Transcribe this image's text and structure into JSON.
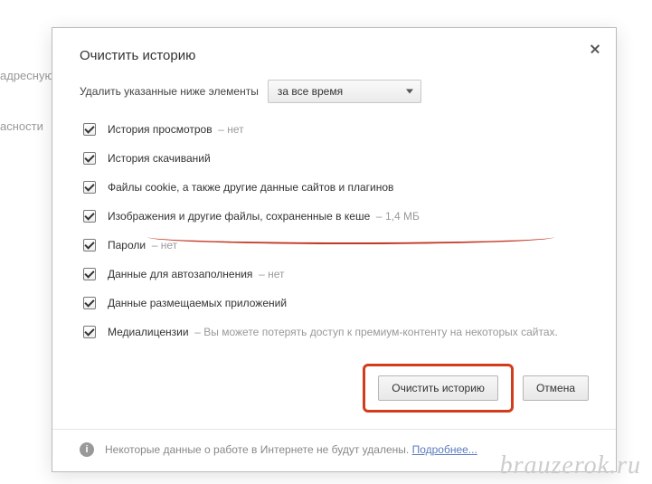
{
  "background": {
    "line1": "адресную с",
    "line2": "асности"
  },
  "dialog": {
    "title": "Очистить историю",
    "range_label": "Удалить указанные ниже элементы",
    "range_value": "за все время",
    "options": [
      {
        "label": "История просмотров",
        "hint": "нет",
        "checked": true
      },
      {
        "label": "История скачиваний",
        "hint": "",
        "checked": true
      },
      {
        "label": "Файлы cookie, а также другие данные сайтов и плагинов",
        "hint": "",
        "checked": true
      },
      {
        "label": "Изображения и другие файлы, сохраненные в кеше",
        "hint": "1,4 МБ",
        "checked": true
      },
      {
        "label": "Пароли",
        "hint": "нет",
        "checked": true
      },
      {
        "label": "Данные для автозаполнения",
        "hint": "нет",
        "checked": true
      },
      {
        "label": "Данные размещаемых приложений",
        "hint": "",
        "checked": true
      },
      {
        "label": "Медиалицензии",
        "hint": "",
        "note": "Вы можете потерять доступ к премиум-контенту на некоторых сайтах.",
        "checked": true
      }
    ],
    "buttons": {
      "clear": "Очистить историю",
      "cancel": "Отмена"
    },
    "footer": {
      "text": "Некоторые данные о работе в Интернете не будут удалены.",
      "link": "Подробнее..."
    }
  },
  "watermark": "brauzerok.ru"
}
